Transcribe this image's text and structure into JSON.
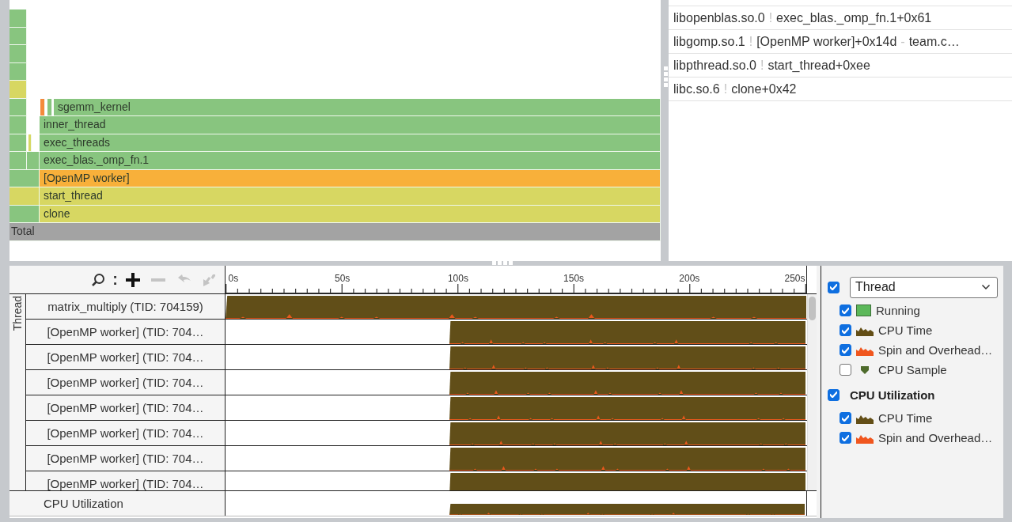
{
  "flame_graph": {
    "rows": [
      {
        "frames": [
          {
            "kind": "side",
            "color": "#88c57f"
          }
        ]
      },
      {
        "frames": [
          {
            "kind": "side",
            "color": "#88c57f"
          }
        ]
      },
      {
        "frames": [
          {
            "kind": "side",
            "color": "#88c57f"
          }
        ]
      },
      {
        "frames": [
          {
            "kind": "side",
            "color": "#88c57f"
          }
        ]
      },
      {
        "frames": [
          {
            "kind": "side",
            "color": "#d7d762"
          }
        ]
      },
      {
        "frames": [
          {
            "kind": "side",
            "color": "#88c57f"
          },
          {
            "kind": "sliver",
            "color": "#f48a3c"
          },
          {
            "kind": "sliver",
            "color": "#88c57f"
          },
          {
            "kind": "frame",
            "label": "sgemm_kernel",
            "color": "#88c57f"
          }
        ]
      },
      {
        "frames": [
          {
            "kind": "side",
            "color": "#88c57f"
          },
          {
            "kind": "frame",
            "label": "inner_thread",
            "color": "#88c57f"
          }
        ]
      },
      {
        "frames": [
          {
            "kind": "side",
            "color": "#88c57f"
          },
          {
            "kind": "gap-sliver",
            "color": "#d7d762"
          },
          {
            "kind": "frame",
            "label": "exec_threads",
            "color": "#88c57f"
          }
        ]
      },
      {
        "frames": [
          {
            "kind": "side",
            "color": "#88c57f"
          },
          {
            "kind": "gap-fill",
            "color": "#88c57f"
          },
          {
            "kind": "frame",
            "label": "exec_blas._omp_fn.1",
            "color": "#88c57f"
          }
        ]
      },
      {
        "frames": [
          {
            "kind": "side-wide",
            "color": "#88c57f"
          },
          {
            "kind": "frame",
            "label": "[OpenMP worker]",
            "color": "#f8b03a"
          }
        ]
      },
      {
        "frames": [
          {
            "kind": "side-wide",
            "color": "#d7d762"
          },
          {
            "kind": "frame",
            "label": "start_thread",
            "color": "#d7d762"
          }
        ]
      },
      {
        "frames": [
          {
            "kind": "side-wide",
            "color": "#88c57f"
          },
          {
            "kind": "frame",
            "label": "clone",
            "color": "#d7d762"
          }
        ]
      },
      {
        "frames": [
          {
            "kind": "total",
            "label": "Total",
            "color": "#a3a3a3"
          }
        ]
      }
    ]
  },
  "stack": {
    "rows": [
      {
        "module": "libopenblas.so.0",
        "separator": "!",
        "function": "exec_blas._omp_fn.1+0x61"
      },
      {
        "module": "libgomp.so.1",
        "separator": "!",
        "function": "[OpenMP worker]+0x14d",
        "source_separator": "-",
        "source": "team.c…"
      },
      {
        "module": "libpthread.so.0",
        "separator": "!",
        "function": "start_thread+0xee"
      },
      {
        "module": "libc.so.6",
        "separator": "!",
        "function": "clone+0x42"
      }
    ]
  },
  "timeline": {
    "zoom_tools": {
      "separator": ":",
      "buttons": [
        {
          "kind": "zoom-in",
          "disabled": false
        },
        {
          "kind": "zoom-out",
          "disabled": true
        },
        {
          "kind": "undo",
          "disabled": true
        },
        {
          "kind": "reset",
          "disabled": true
        }
      ]
    },
    "ticks": [
      "0s",
      "50s",
      "100s",
      "150s",
      "200s",
      "250s"
    ],
    "group_label": "Thread",
    "threads": [
      {
        "name": "matrix_multiply (TID: 704159)",
        "kind": "full"
      },
      {
        "name": "[OpenMP worker] (TID: 704…",
        "kind": "late"
      },
      {
        "name": "[OpenMP worker] (TID: 704…",
        "kind": "late"
      },
      {
        "name": "[OpenMP worker] (TID: 704…",
        "kind": "late"
      },
      {
        "name": "[OpenMP worker] (TID: 704…",
        "kind": "late"
      },
      {
        "name": "[OpenMP worker] (TID: 704…",
        "kind": "late"
      },
      {
        "name": "[OpenMP worker] (TID: 704…",
        "kind": "late"
      },
      {
        "name": "[OpenMP worker] (TID: 704…",
        "kind": "late"
      }
    ],
    "utilization": {
      "name": "CPU Utilization",
      "kind": "late"
    }
  },
  "legend": {
    "groups": [
      {
        "kind": "select",
        "label": "Thread",
        "checked": true,
        "items": [
          {
            "label": "Running",
            "kind": "swatch",
            "color": "#5cb85a",
            "checked": true
          },
          {
            "label": "CPU Time",
            "kind": "area",
            "color": "#634e16",
            "checked": true
          },
          {
            "label": "Spin and Overhead…",
            "kind": "area",
            "color": "#f0561e",
            "checked": true
          },
          {
            "label": "CPU Sample",
            "kind": "marker",
            "color": "#4e6b2c",
            "checked": false
          }
        ]
      },
      {
        "kind": "heading",
        "label": "CPU Utilization",
        "checked": true,
        "items": [
          {
            "label": "CPU Time",
            "kind": "area",
            "color": "#634e16",
            "checked": true
          },
          {
            "label": "Spin and Overhead…",
            "kind": "area",
            "color": "#f0561e",
            "checked": true
          }
        ]
      }
    ]
  }
}
